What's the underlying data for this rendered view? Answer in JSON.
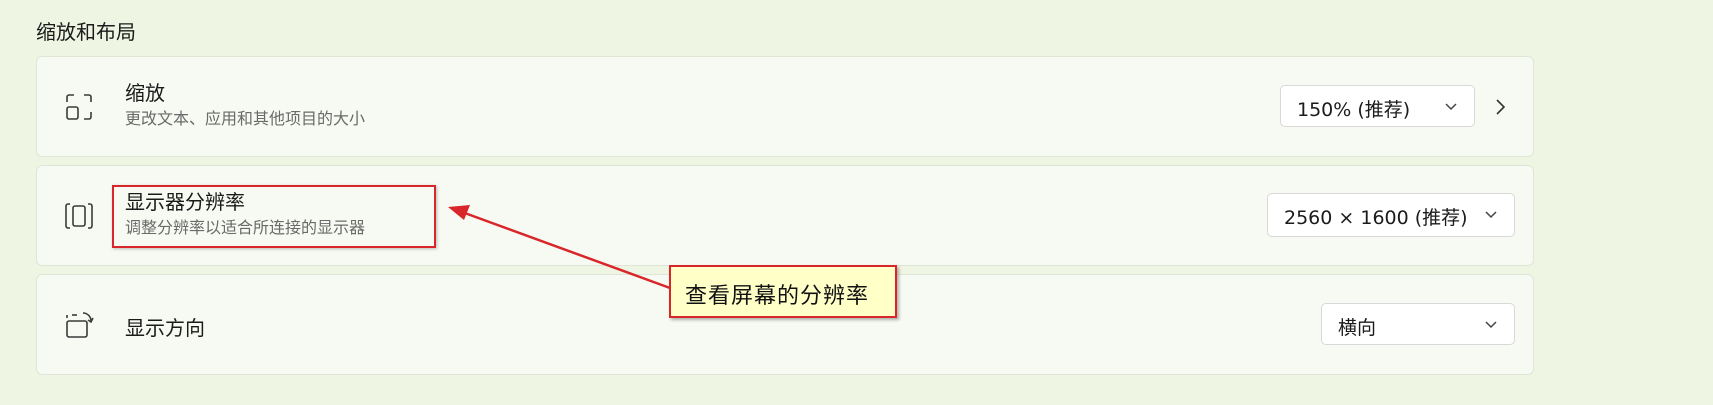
{
  "section": {
    "title": "缩放和布局"
  },
  "scale": {
    "title": "缩放",
    "subtitle": "更改文本、应用和其他项目的大小",
    "dropdown_value": "150% (推荐)",
    "icon": "scale-icon"
  },
  "resolution": {
    "title": "显示器分辨率",
    "subtitle": "调整分辨率以适合所连接的显示器",
    "dropdown_value": "2560 × 1600 (推荐)",
    "icon": "resolution-icon"
  },
  "orientation": {
    "title": "显示方向",
    "dropdown_value": "横向",
    "icon": "orientation-icon"
  },
  "annotation": {
    "callout_text": "查看屏幕的分辨率",
    "color": "#d8262a",
    "callout_bg": "#ffffc8"
  },
  "colors": {
    "page_bg": "#eef5e2",
    "card_bg": "#f7faf2"
  }
}
